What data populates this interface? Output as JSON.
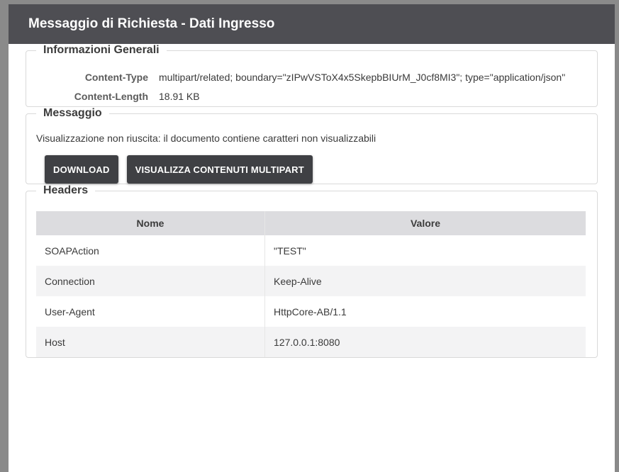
{
  "dialog": {
    "title": "Messaggio di Richiesta - Dati Ingresso"
  },
  "info": {
    "legend": "Informazioni Generali",
    "rows": [
      {
        "key": "Content-Type",
        "value": "multipart/related; boundary=\"zIPwVSToX4x5SkepbBIUrM_J0cf8MI3\"; type=\"application/json\""
      },
      {
        "key": "Content-Length",
        "value": "18.91 KB"
      }
    ]
  },
  "message": {
    "legend": "Messaggio",
    "text": "Visualizzazione non riuscita: il documento contiene caratteri non visualizzabili",
    "download_label": "DOWNLOAD",
    "multipart_label": "VISUALIZZA CONTENUTI MULTIPART"
  },
  "headers": {
    "legend": "Headers",
    "columns": [
      "Nome",
      "Valore"
    ],
    "rows": [
      {
        "name": "SOAPAction",
        "value": "\"TEST\""
      },
      {
        "name": "Connection",
        "value": "Keep-Alive"
      },
      {
        "name": "User-Agent",
        "value": "HttpCore-AB/1.1"
      },
      {
        "name": "Host",
        "value": "127.0.0.1:8080"
      }
    ]
  }
}
